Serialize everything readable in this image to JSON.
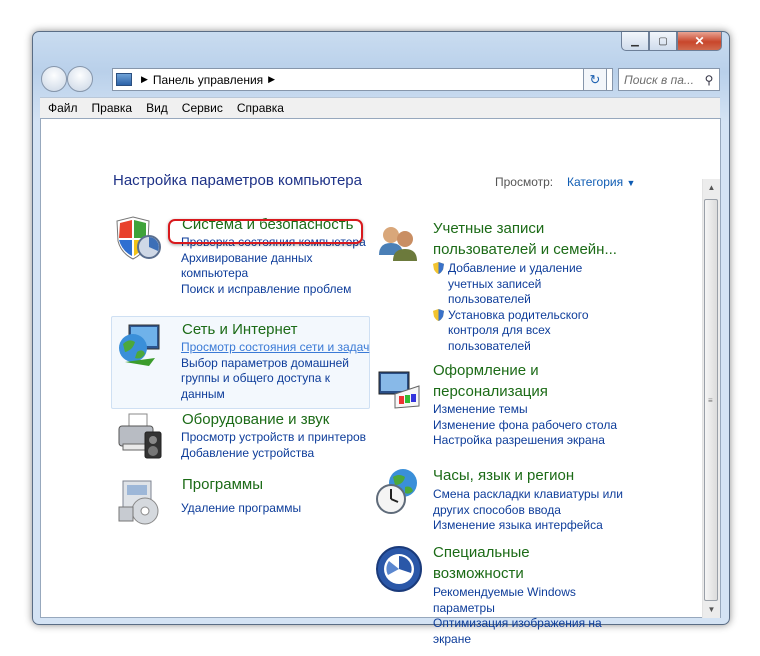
{
  "window": {
    "address_path": "Панель управления",
    "search_placeholder": "Поиск в па..."
  },
  "menu": [
    "Файл",
    "Правка",
    "Вид",
    "Сервис",
    "Справка"
  ],
  "page": {
    "title": "Настройка параметров компьютера",
    "view_by_label": "Просмотр:",
    "view_by_value": "Категория"
  },
  "categories": {
    "security": {
      "title": "Система и безопасность",
      "links": [
        "Проверка состояния компьютера",
        "Архивирование данных",
        "компьютера",
        "Поиск и исправление проблем"
      ]
    },
    "network": {
      "title": "Сеть и Интернет",
      "links": [
        "Просмотр состояния сети и задач",
        "Выбор параметров домашней",
        "группы и общего доступа к",
        "данным"
      ]
    },
    "hardware": {
      "title": "Оборудование и звук",
      "links": [
        "Просмотр устройств и принтеров",
        "Добавление устройства"
      ]
    },
    "programs": {
      "title": "Программы",
      "links": [
        "Удаление программы"
      ]
    },
    "users": {
      "title_line1": "Учетные записи",
      "title_line2": "пользователей и семейн...",
      "links": [
        "Добавление и удаление",
        "учетных записей",
        "пользователей",
        "Установка родительского",
        "контроля для всех",
        "пользователей"
      ]
    },
    "appearance": {
      "title_line1": "Оформление и",
      "title_line2": "персонализация",
      "links": [
        "Изменение темы",
        "Изменение фона рабочего стола",
        "Настройка разрешения экрана"
      ]
    },
    "clock": {
      "title": "Часы, язык и регион",
      "links": [
        "Смена раскладки клавиатуры или",
        "других способов ввода",
        "Изменение языка интерфейса"
      ]
    },
    "access": {
      "title_line1": "Специальные",
      "title_line2": "возможности",
      "links": [
        "Рекомендуемые Windows",
        "параметры",
        "Оптимизация изображения на",
        "экране"
      ]
    }
  }
}
